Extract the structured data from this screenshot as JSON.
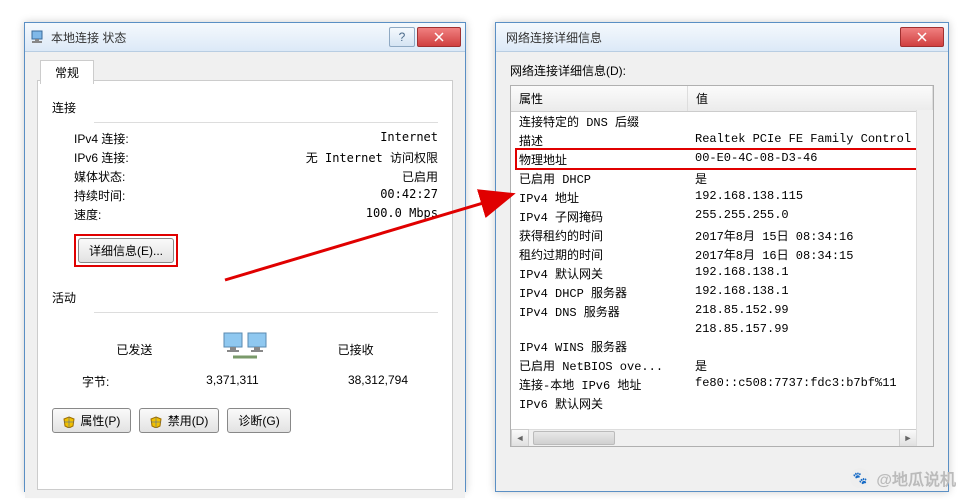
{
  "left": {
    "title": "本地连接 状态",
    "tab": "常规",
    "conn_label": "连接",
    "rows": [
      {
        "k": "IPv4 连接:",
        "v": "Internet"
      },
      {
        "k": "IPv6 连接:",
        "v": "无 Internet 访问权限"
      },
      {
        "k": "媒体状态:",
        "v": "已启用"
      },
      {
        "k": "持续时间:",
        "v": "00:42:27"
      },
      {
        "k": "速度:",
        "v": "100.0 Mbps"
      }
    ],
    "details_btn": "详细信息(E)...",
    "activity_label": "活动",
    "sent": "已发送",
    "recv": "已接收",
    "bytes_label": "字节:",
    "bytes_sent": "3,371,311",
    "bytes_recv": "38,312,794",
    "btn_props": "属性(P)",
    "btn_disable": "禁用(D)",
    "btn_diag": "诊断(G)"
  },
  "right": {
    "title": "网络连接详细信息",
    "list_label": "网络连接详细信息(D):",
    "col_prop": "属性",
    "col_val": "值",
    "rows": [
      {
        "p": "连接特定的 DNS 后缀",
        "v": ""
      },
      {
        "p": "描述",
        "v": "Realtek PCIe FE Family Control"
      },
      {
        "p": "物理地址",
        "v": "00-E0-4C-08-D3-46",
        "hl": true
      },
      {
        "p": "已启用 DHCP",
        "v": "是"
      },
      {
        "p": "IPv4 地址",
        "v": "192.168.138.115"
      },
      {
        "p": "IPv4 子网掩码",
        "v": "255.255.255.0"
      },
      {
        "p": "获得租约的时间",
        "v": "2017年8月 15日 08:34:16"
      },
      {
        "p": "租约过期的时间",
        "v": "2017年8月 16日 08:34:15"
      },
      {
        "p": "IPv4 默认网关",
        "v": "192.168.138.1"
      },
      {
        "p": "IPv4 DHCP 服务器",
        "v": "192.168.138.1"
      },
      {
        "p": "IPv4 DNS 服务器",
        "v": "218.85.152.99"
      },
      {
        "p": "",
        "v": "218.85.157.99"
      },
      {
        "p": "IPv4 WINS 服务器",
        "v": ""
      },
      {
        "p": "已启用 NetBIOS ove...",
        "v": "是"
      },
      {
        "p": "连接-本地 IPv6 地址",
        "v": "fe80::c508:7737:fdc3:b7bf%11"
      },
      {
        "p": "IPv6 默认网关",
        "v": ""
      }
    ]
  },
  "watermark": "@地瓜说机"
}
